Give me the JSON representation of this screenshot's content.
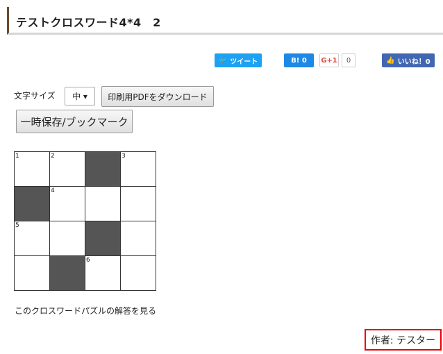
{
  "page": {
    "title": "テストクロスワード4*4　2"
  },
  "share": {
    "tweet": "ツイート",
    "hatena": "B! 0",
    "gplus": "G+1",
    "gplus_count": "0",
    "facebook": "いいね！0"
  },
  "controls": {
    "font_size_label": "文字サイズ",
    "font_size_value": "中 ▾",
    "pdf_button": "印刷用PDFをダウンロード",
    "save_button": "一時保存/ブックマーク"
  },
  "crossword": {
    "rows": [
      [
        {
          "num": "1",
          "dark": false
        },
        {
          "num": "2",
          "dark": false
        },
        {
          "num": "",
          "dark": true
        },
        {
          "num": "3",
          "dark": false
        }
      ],
      [
        {
          "num": "",
          "dark": true
        },
        {
          "num": "4",
          "dark": false
        },
        {
          "num": "",
          "dark": false
        },
        {
          "num": "",
          "dark": false
        }
      ],
      [
        {
          "num": "5",
          "dark": false
        },
        {
          "num": "",
          "dark": false
        },
        {
          "num": "",
          "dark": true
        },
        {
          "num": "",
          "dark": false
        }
      ],
      [
        {
          "num": "",
          "dark": false
        },
        {
          "num": "",
          "dark": true
        },
        {
          "num": "6",
          "dark": false
        },
        {
          "num": "",
          "dark": false
        }
      ]
    ]
  },
  "links": {
    "answer": "このクロスワードパズルの解答を見る"
  },
  "author": {
    "label": "作者: テスター"
  },
  "colors": {
    "accent_border": "#6b4a2b",
    "highlight": "#e00000",
    "twitter": "#1da1f2",
    "hatena": "#1e88e5",
    "facebook": "#4267b2"
  }
}
